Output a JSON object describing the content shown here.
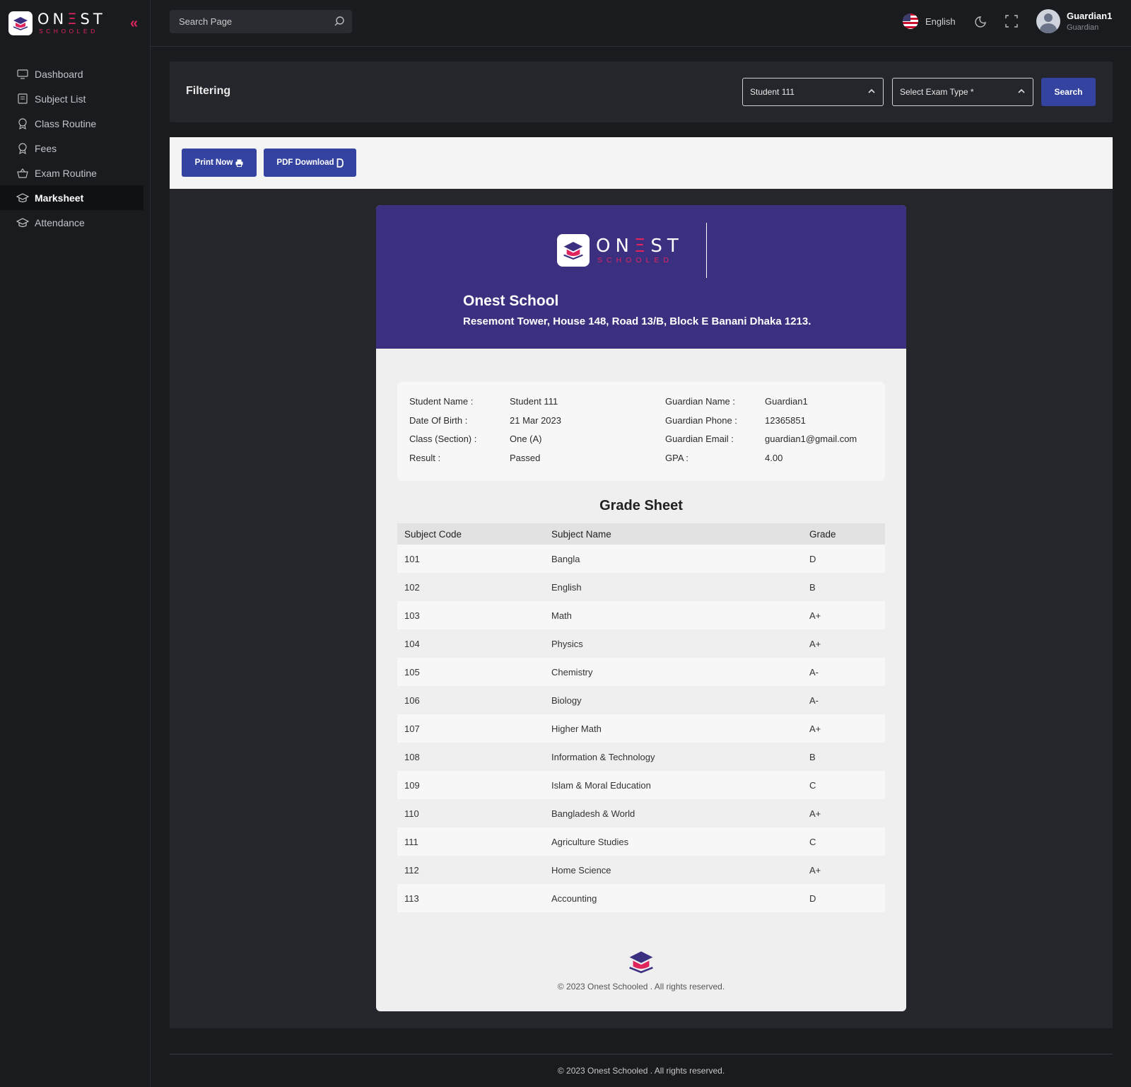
{
  "brand": {
    "name_pre": "ON",
    "name_e": "Ξ",
    "name_post": "ST",
    "sub": "SCHOOLED"
  },
  "sidebar": {
    "items": [
      {
        "label": "Dashboard",
        "icon": "monitor-icon",
        "active": false
      },
      {
        "label": "Subject List",
        "icon": "list-icon",
        "active": false
      },
      {
        "label": "Class Routine",
        "icon": "award-icon",
        "active": false
      },
      {
        "label": "Fees",
        "icon": "award-icon",
        "active": false
      },
      {
        "label": "Exam Routine",
        "icon": "basket-icon",
        "active": false
      },
      {
        "label": "Marksheet",
        "icon": "graduation-cap-icon",
        "active": true
      },
      {
        "label": "Attendance",
        "icon": "graduation-cap-icon",
        "active": false
      }
    ]
  },
  "topbar": {
    "search_placeholder": "Search Page",
    "language": "English",
    "user_name": "Guardian1",
    "user_role": "Guardian"
  },
  "filter": {
    "title": "Filtering",
    "student_select": "Student 111",
    "exam_select": "Select Exam Type *",
    "search_label": "Search"
  },
  "actions": {
    "print_label": "Print Now",
    "pdf_label": "PDF Download"
  },
  "sheet": {
    "school_name": "Onest School",
    "school_address": "Resemont Tower, House 148, Road 13/B, Block E Banani Dhaka 1213.",
    "info": [
      {
        "label": "Student Name :",
        "value": "Student 111",
        "label2": "Guardian Name :",
        "value2": "Guardian1"
      },
      {
        "label": "Date Of Birth :",
        "value": "21 Mar 2023",
        "label2": "Guardian Phone :",
        "value2": "12365851"
      },
      {
        "label": "Class (Section) :",
        "value": "One (A)",
        "label2": "Guardian Email :",
        "value2": "guardian1@gmail.com"
      },
      {
        "label": "Result :",
        "value": "Passed",
        "label2": "GPA :",
        "value2": "4.00"
      }
    ],
    "grade_title": "Grade Sheet",
    "columns": [
      "Subject Code",
      "Subject Name",
      "Grade"
    ],
    "rows": [
      [
        "101",
        "Bangla",
        "D"
      ],
      [
        "102",
        "English",
        "B"
      ],
      [
        "103",
        "Math",
        "A+"
      ],
      [
        "104",
        "Physics",
        "A+"
      ],
      [
        "105",
        "Chemistry",
        "A-"
      ],
      [
        "106",
        "Biology",
        "A-"
      ],
      [
        "107",
        "Higher Math",
        "A+"
      ],
      [
        "108",
        "Information & Technology",
        "B"
      ],
      [
        "109",
        "Islam & Moral Education",
        "C"
      ],
      [
        "110",
        "Bangladesh & World",
        "A+"
      ],
      [
        "111",
        "Agriculture Studies",
        "C"
      ],
      [
        "112",
        "Home Science",
        "A+"
      ],
      [
        "113",
        "Accounting",
        "D"
      ]
    ],
    "footer": "© 2023 Onest Schooled . All rights reserved."
  },
  "page_footer": "© 2023 Onest Schooled . All rights reserved.",
  "colors": {
    "accent": "#3442a0",
    "brand_pink": "#e0245e",
    "header_purple": "#3b2f80"
  }
}
